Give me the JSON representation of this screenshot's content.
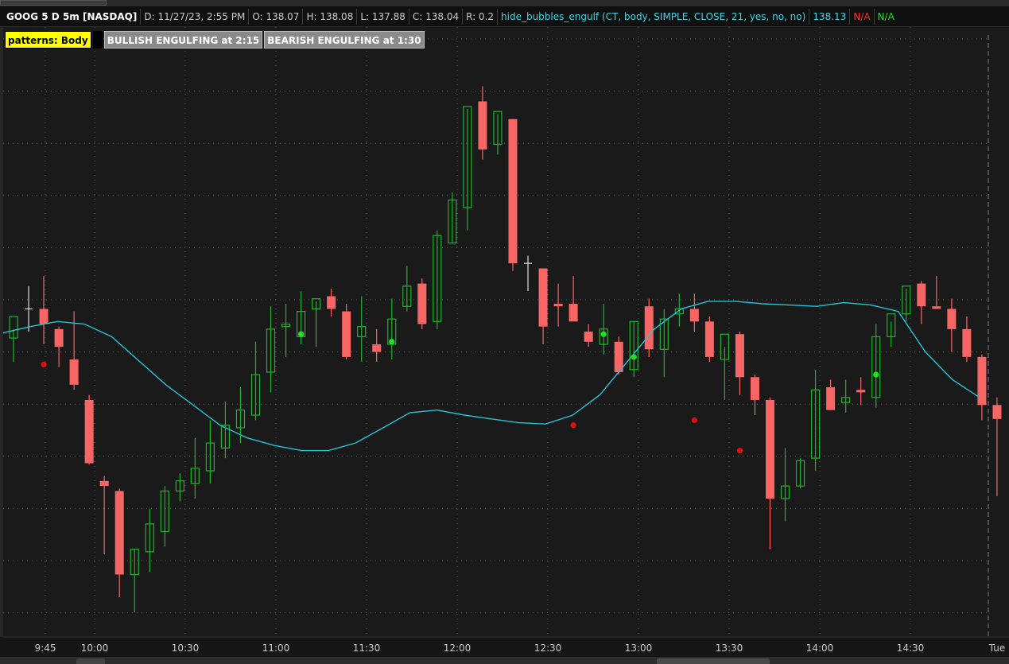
{
  "header": {
    "symbol": "GOOG 5 D 5m [NASDAQ]",
    "date": "D: 11/27/23, 2:55 PM",
    "open": "O: 138.07",
    "high": "H: 138.08",
    "low": "L: 137.88",
    "close": "C: 138.04",
    "range": "R: 0.2",
    "indicator": "hide_bubbles_engulf (CT, body, SIMPLE, CLOSE, 21, yes, no, no)",
    "indicator_value": "138.13",
    "na_red": "N/A",
    "na_green": "N/A"
  },
  "patterns": {
    "label": "patterns: Body",
    "bullish": "BULLISH ENGULFING at 2:15",
    "bearish": "BEARISH ENGULFING at 1:30"
  },
  "colors": {
    "background": "#1a1a1a",
    "up": "#1db32a",
    "down": "#f86565",
    "ma": "#26c2d4",
    "bull_dot": "#22e022",
    "bear_dot": "#e01010",
    "grid": "#5a5a5a"
  },
  "chart_data": {
    "type": "candlestick",
    "x_tick_labels": [
      "9:45",
      "10:00",
      "10:30",
      "11:00",
      "11:30",
      "12:00",
      "12:30",
      "13:00",
      "13:30",
      "14:00",
      "14:30",
      "Tue"
    ],
    "candles": [
      {
        "o": 138.15,
        "h": 138.22,
        "l": 137.96,
        "c": 138.32
      },
      {
        "o": 138.38,
        "h": 138.56,
        "l": 138.2,
        "c": 138.38
      },
      {
        "o": 138.38,
        "h": 138.64,
        "l": 138.1,
        "c": 138.26
      },
      {
        "o": 138.22,
        "h": 138.24,
        "l": 137.92,
        "c": 138.08
      },
      {
        "o": 137.98,
        "h": 138.36,
        "l": 137.74,
        "c": 137.78
      },
      {
        "o": 137.66,
        "h": 137.7,
        "l": 137.15,
        "c": 137.16
      },
      {
        "o": 137.02,
        "h": 137.06,
        "l": 136.44,
        "c": 136.98
      },
      {
        "o": 136.94,
        "h": 136.96,
        "l": 136.1,
        "c": 136.28
      },
      {
        "o": 136.28,
        "h": 136.48,
        "l": 135.98,
        "c": 136.48
      },
      {
        "o": 136.46,
        "h": 136.8,
        "l": 136.3,
        "c": 136.68
      },
      {
        "o": 136.62,
        "h": 136.98,
        "l": 136.5,
        "c": 136.94
      },
      {
        "o": 136.94,
        "h": 137.08,
        "l": 136.86,
        "c": 137.02
      },
      {
        "o": 137.0,
        "h": 137.36,
        "l": 136.88,
        "c": 137.12
      },
      {
        "o": 137.1,
        "h": 137.5,
        "l": 137.0,
        "c": 137.32
      },
      {
        "o": 137.28,
        "h": 137.65,
        "l": 137.2,
        "c": 137.46
      },
      {
        "o": 137.44,
        "h": 137.76,
        "l": 137.32,
        "c": 137.58
      },
      {
        "o": 137.54,
        "h": 138.12,
        "l": 137.5,
        "c": 137.86
      },
      {
        "o": 137.88,
        "h": 138.4,
        "l": 137.72,
        "c": 138.22
      },
      {
        "o": 138.24,
        "h": 138.42,
        "l": 138.0,
        "c": 138.26
      },
      {
        "o": 138.16,
        "h": 138.52,
        "l": 138.1,
        "c": 138.36
      },
      {
        "o": 138.38,
        "h": 138.44,
        "l": 138.08,
        "c": 138.46
      },
      {
        "o": 138.48,
        "h": 138.54,
        "l": 138.32,
        "c": 138.38
      },
      {
        "o": 138.36,
        "h": 138.42,
        "l": 137.98,
        "c": 138.0
      },
      {
        "o": 138.16,
        "h": 138.48,
        "l": 137.96,
        "c": 138.24
      },
      {
        "o": 138.1,
        "h": 138.22,
        "l": 137.96,
        "c": 138.04
      },
      {
        "o": 138.1,
        "h": 138.46,
        "l": 137.98,
        "c": 138.3
      },
      {
        "o": 138.4,
        "h": 138.72,
        "l": 138.36,
        "c": 138.56
      },
      {
        "o": 138.58,
        "h": 138.62,
        "l": 138.22,
        "c": 138.26
      },
      {
        "o": 138.28,
        "h": 139.0,
        "l": 138.22,
        "c": 138.96
      },
      {
        "o": 138.9,
        "h": 139.3,
        "l": 138.9,
        "c": 139.24
      },
      {
        "o": 139.18,
        "h": 139.96,
        "l": 139.0,
        "c": 139.98
      },
      {
        "o": 140.02,
        "h": 140.14,
        "l": 139.56,
        "c": 139.64
      },
      {
        "o": 139.68,
        "h": 139.92,
        "l": 139.6,
        "c": 139.94
      },
      {
        "o": 139.88,
        "h": 139.88,
        "l": 138.68,
        "c": 138.74
      },
      {
        "o": 138.74,
        "h": 138.8,
        "l": 138.52,
        "c": 138.74
      },
      {
        "o": 138.7,
        "h": 138.7,
        "l": 138.1,
        "c": 138.24
      },
      {
        "o": 138.42,
        "h": 138.58,
        "l": 138.24,
        "c": 138.4
      },
      {
        "o": 138.42,
        "h": 138.64,
        "l": 138.3,
        "c": 138.28
      },
      {
        "o": 138.2,
        "h": 138.26,
        "l": 138.08,
        "c": 138.12
      },
      {
        "o": 138.1,
        "h": 138.42,
        "l": 138.02,
        "c": 138.22
      },
      {
        "o": 138.12,
        "h": 138.16,
        "l": 137.86,
        "c": 137.88
      },
      {
        "o": 137.9,
        "h": 138.28,
        "l": 137.84,
        "c": 138.28
      },
      {
        "o": 138.4,
        "h": 138.46,
        "l": 138.0,
        "c": 138.06
      },
      {
        "o": 138.06,
        "h": 138.38,
        "l": 137.84,
        "c": 138.3
      },
      {
        "o": 138.34,
        "h": 138.5,
        "l": 138.24,
        "c": 138.38
      },
      {
        "o": 138.38,
        "h": 138.5,
        "l": 138.2,
        "c": 138.28
      },
      {
        "o": 138.28,
        "h": 138.32,
        "l": 137.96,
        "c": 138.0
      },
      {
        "o": 137.98,
        "h": 138.08,
        "l": 137.66,
        "c": 138.18
      },
      {
        "o": 138.18,
        "h": 138.2,
        "l": 137.7,
        "c": 137.84
      },
      {
        "o": 137.84,
        "h": 137.86,
        "l": 137.54,
        "c": 137.66
      },
      {
        "o": 137.66,
        "h": 137.68,
        "l": 136.48,
        "c": 136.88
      },
      {
        "o": 136.88,
        "h": 137.28,
        "l": 136.7,
        "c": 136.98
      },
      {
        "o": 136.98,
        "h": 137.2,
        "l": 136.96,
        "c": 137.18
      },
      {
        "o": 137.2,
        "h": 137.9,
        "l": 137.1,
        "c": 137.74
      },
      {
        "o": 137.76,
        "h": 137.82,
        "l": 137.58,
        "c": 137.58
      },
      {
        "o": 137.64,
        "h": 137.82,
        "l": 137.56,
        "c": 137.68
      },
      {
        "o": 137.74,
        "h": 137.84,
        "l": 137.62,
        "c": 137.72
      },
      {
        "o": 137.68,
        "h": 138.26,
        "l": 137.6,
        "c": 138.16
      },
      {
        "o": 138.16,
        "h": 138.28,
        "l": 138.08,
        "c": 138.34
      },
      {
        "o": 138.34,
        "h": 138.54,
        "l": 138.28,
        "c": 138.56
      },
      {
        "o": 138.58,
        "h": 138.6,
        "l": 138.26,
        "c": 138.4
      },
      {
        "o": 138.4,
        "h": 138.64,
        "l": 138.4,
        "c": 138.38
      },
      {
        "o": 138.38,
        "h": 138.46,
        "l": 138.04,
        "c": 138.22
      },
      {
        "o": 138.22,
        "h": 138.32,
        "l": 137.96,
        "c": 138.0
      },
      {
        "o": 138.0,
        "h": 138.02,
        "l": 137.5,
        "c": 137.62
      },
      {
        "o": 137.62,
        "h": 137.68,
        "l": 136.9,
        "c": 137.51
      }
    ],
    "ma_line": [
      138.19,
      138.24,
      138.28,
      138.26,
      138.16,
      137.97,
      137.78,
      137.62,
      137.46,
      137.36,
      137.3,
      137.26,
      137.26,
      137.32,
      137.44,
      137.56,
      137.58,
      137.54,
      137.51,
      137.48,
      137.47,
      137.54,
      137.7,
      137.96,
      138.22,
      138.38,
      138.44,
      138.44,
      138.42,
      138.41,
      138.4,
      138.43,
      138.41,
      138.36,
      138.04,
      137.82,
      137.68
    ],
    "bull_dots": [
      {
        "index": 19,
        "price": 138.18
      },
      {
        "index": 25,
        "price": 138.12
      },
      {
        "index": 39,
        "price": 138.18
      },
      {
        "index": 41,
        "price": 138.0
      },
      {
        "index": 57,
        "price": 137.86
      }
    ],
    "bear_dots": [
      {
        "index": 2,
        "price": 137.94
      },
      {
        "index": 37,
        "price": 137.46
      },
      {
        "index": 45,
        "price": 137.5
      },
      {
        "index": 48,
        "price": 137.26
      }
    ],
    "ylim": [
      135.95,
      140.35
    ],
    "grid": true,
    "legend": "top-left"
  }
}
